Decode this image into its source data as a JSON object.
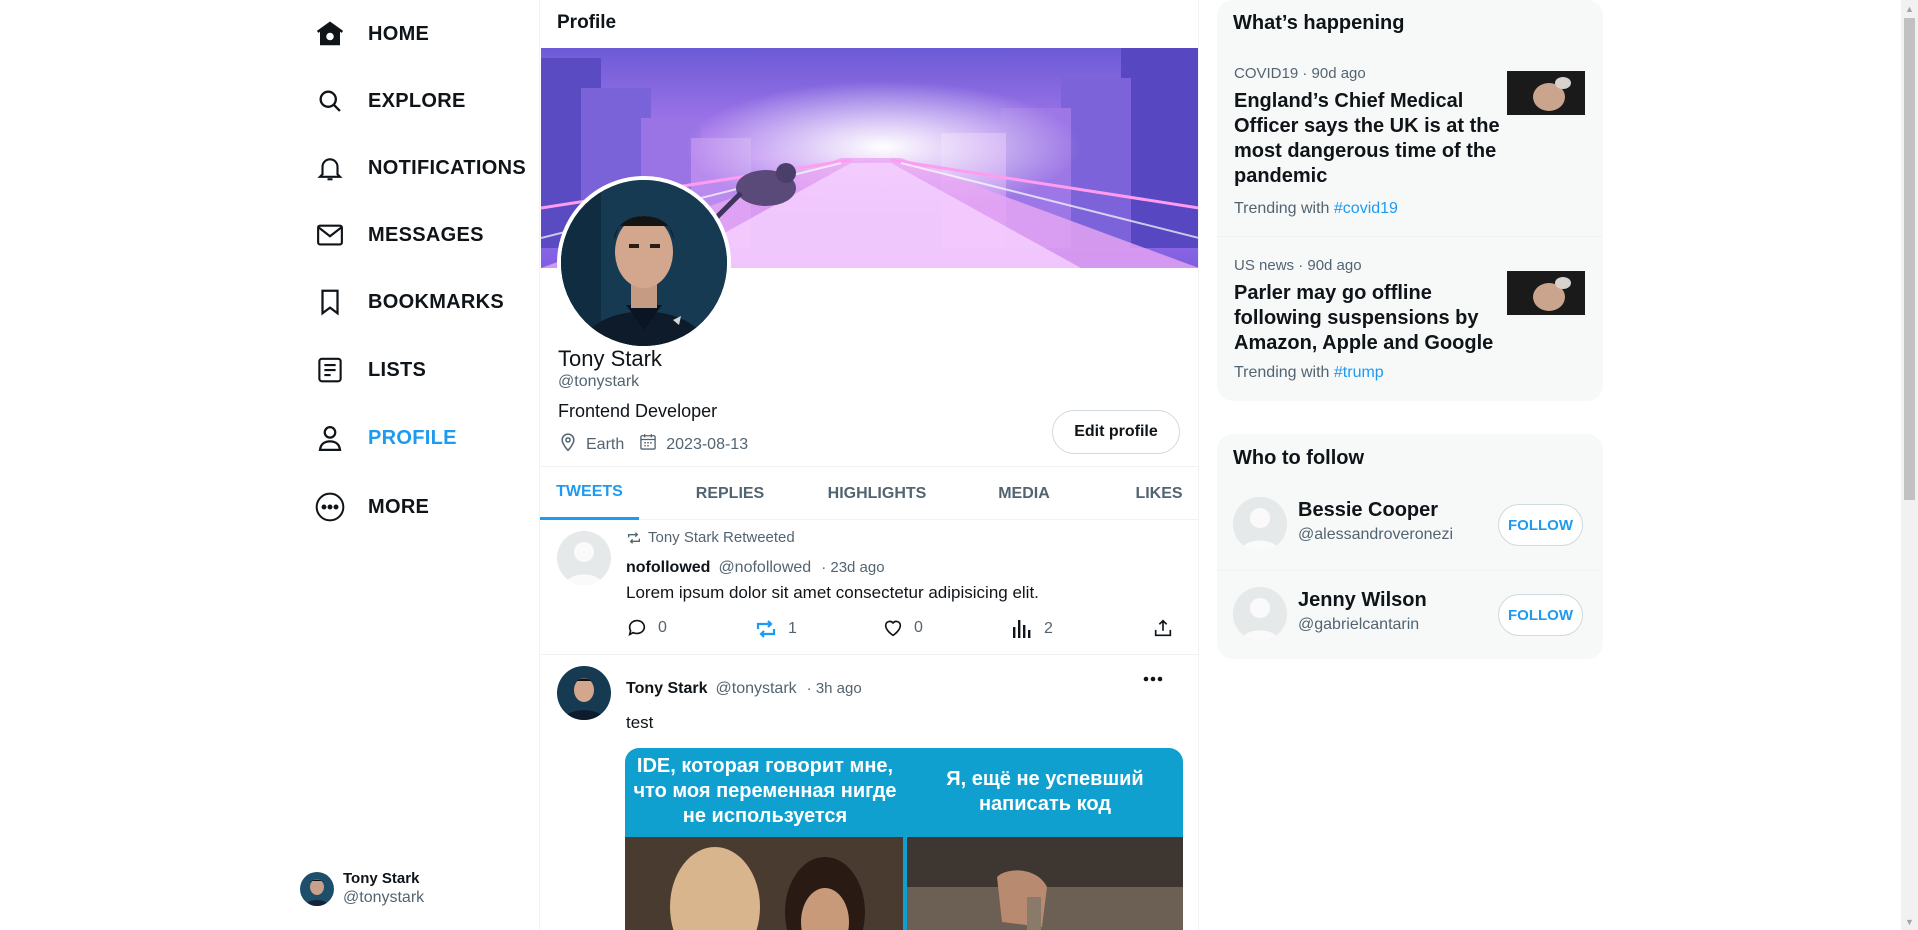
{
  "nav": {
    "items": [
      {
        "label": "HOME",
        "icon": "home-icon"
      },
      {
        "label": "EXPLORE",
        "icon": "search-icon"
      },
      {
        "label": "NOTIFICATIONS",
        "icon": "bell-icon"
      },
      {
        "label": "MESSAGES",
        "icon": "mail-icon"
      },
      {
        "label": "BOOKMARKS",
        "icon": "bookmark-icon"
      },
      {
        "label": "LISTS",
        "icon": "list-icon"
      },
      {
        "label": "PROFILE",
        "icon": "user-icon"
      },
      {
        "label": "MORE",
        "icon": "more-icon"
      }
    ],
    "active": "PROFILE",
    "user": {
      "name": "Tony Stark",
      "handle": "@tonystark"
    }
  },
  "colors": {
    "accent": "#1d9bf0",
    "text": "#0f1419",
    "muted": "#536471",
    "panel": "#f7f9f9"
  },
  "main": {
    "title": "Profile",
    "profile": {
      "name": "Tony Stark",
      "handle": "@tonystark",
      "bio": "Frontend Developer",
      "location": "Earth",
      "joined": "2023-08-13",
      "edit_label": "Edit profile"
    },
    "tabs": [
      {
        "label": "TWEETS",
        "active": true
      },
      {
        "label": "REPLIES"
      },
      {
        "label": "HIGHLIGHTS"
      },
      {
        "label": "MEDIA"
      },
      {
        "label": "LIKES"
      }
    ],
    "tweets": [
      {
        "retweeted_by": "Tony Stark Retweeted",
        "name": "nofollowed",
        "handle": "@nofollowed",
        "time": "· 23d ago",
        "text": "Lorem ipsum dolor sit amet consectetur adipisicing elit.",
        "replies": "0",
        "retweets": "1",
        "likes": "0",
        "views": "2"
      },
      {
        "name": "Tony Stark",
        "handle": "@tonystark",
        "time": "· 3h ago",
        "text": "test",
        "meme_left": "IDE, которая говорит мне, что моя переменная нигде не используется",
        "meme_right": "Я, ещё не успевший написать код"
      }
    ]
  },
  "trends": {
    "title": "What’s happening",
    "items": [
      {
        "category": "COVID19 · 90d ago",
        "headline": "England’s Chief Medical Officer says the UK is at the most dangerous time of the pandemic",
        "trending_prefix": "Trending with",
        "hashtag": "#covid19"
      },
      {
        "category": "US news · 90d ago",
        "headline": "Parler may go offline following suspensions by Amazon, Apple and Google",
        "trending_prefix": "Trending with",
        "hashtag": "#trump"
      }
    ]
  },
  "who_to_follow": {
    "title": "Who to follow",
    "users": [
      {
        "name": "Bessie Cooper",
        "handle": "@alessandroveronezi",
        "button": "FOLLOW"
      },
      {
        "name": "Jenny Wilson",
        "handle": "@gabrielcantarin",
        "button": "FOLLOW"
      }
    ]
  }
}
